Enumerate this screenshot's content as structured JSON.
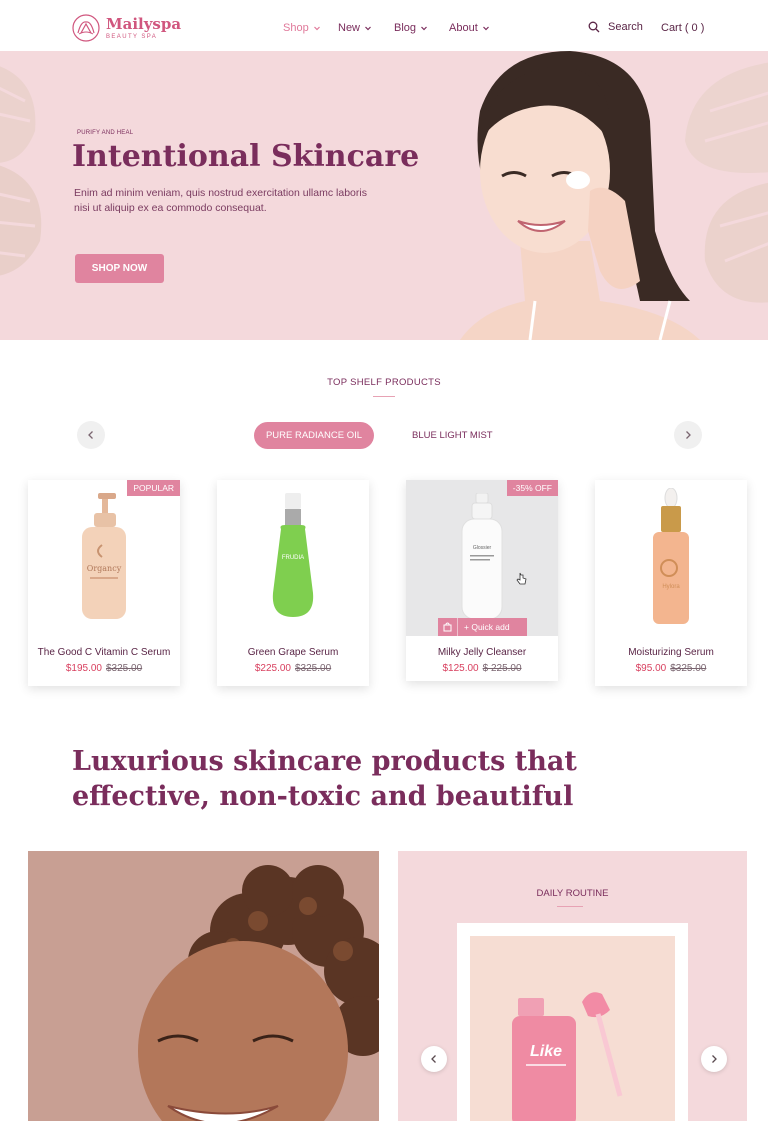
{
  "header": {
    "brand_name": "Mailyspa",
    "brand_tagline": "BEAUTY SPA",
    "nav": [
      {
        "label": "Shop"
      },
      {
        "label": "New"
      },
      {
        "label": "Blog"
      },
      {
        "label": "About"
      }
    ],
    "search_label": "Search",
    "cart_label": "Cart ( 0 )"
  },
  "hero": {
    "eyebrow": "PURIFY AND HEAL",
    "title": "Intentional Skincare",
    "description": "Enim ad minim veniam, quis nostrud exercitation ullamc laboris nisi ut aliquip ex ea commodo consequat.",
    "button_label": "SHOP NOW"
  },
  "shelf": {
    "title": "TOP SHELF PRODUCTS",
    "tabs": [
      {
        "label": "PURE RADIANCE OIL",
        "active": true
      },
      {
        "label": "BLUE LIGHT MIST",
        "active": false
      }
    ],
    "products": [
      {
        "name": "The Good C Vitamin C Serum",
        "price": "$195.00",
        "old_price": "$325.00",
        "badge": "POPULAR",
        "bottle_label": "Organcy"
      },
      {
        "name": "Green Grape Serum",
        "price": "$225.00",
        "old_price": "$325.00",
        "badge": "",
        "bottle_label": "FRUDIA"
      },
      {
        "name": "Milky Jelly Cleanser",
        "price": "$125.00",
        "old_price": "$ 225.00",
        "badge": "-35% OFF",
        "quick_add": "Quick add",
        "bottle_label": "Glossier"
      },
      {
        "name": "Moisturizing Serum",
        "price": "$95.00",
        "old_price": "$325.00",
        "badge": "",
        "bottle_label": "Hylora"
      }
    ]
  },
  "headline": "Luxurious skincare products that effective, non-toxic and beautiful",
  "routine": {
    "title": "DAILY ROUTINE",
    "bottle_label": "Like"
  },
  "colors": {
    "accent": "#e0849f",
    "brand": "#7a2d5c",
    "hero_bg": "#f4d9dc",
    "sale": "#d8405f"
  }
}
